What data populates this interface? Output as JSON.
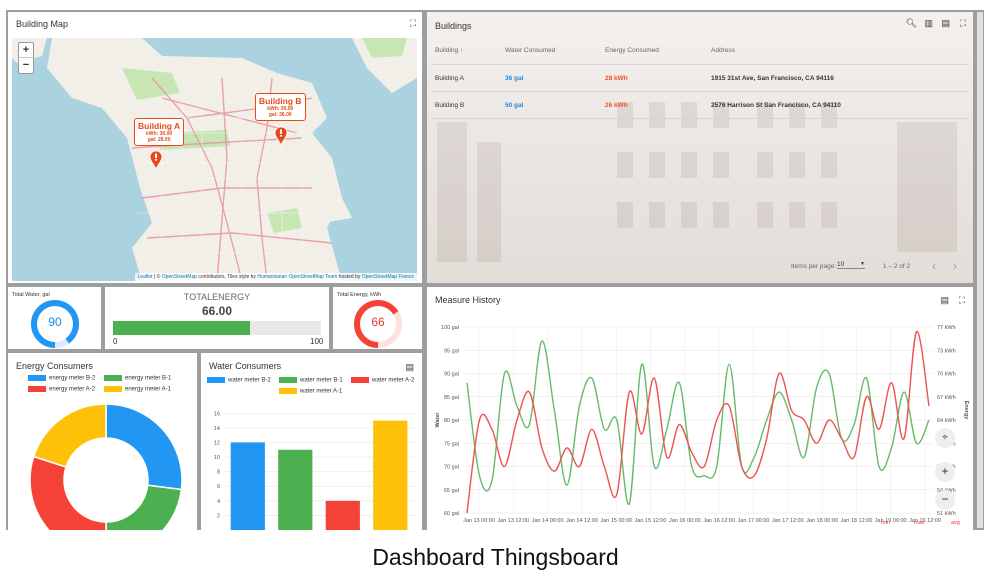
{
  "map": {
    "title": "Building Map",
    "zoom_in": "+",
    "zoom_out": "−",
    "popups": [
      {
        "name": "Building A",
        "kwh": "kWh: 36.00",
        "gal": "gal: 28.00"
      },
      {
        "name": "Building B",
        "kwh": "kWh: 36.00",
        "gal": "gal: 36.00"
      }
    ],
    "attribution": {
      "leaflet": "Leaflet",
      "sep1": " | © ",
      "osm": "OpenStreetMap",
      "mid": " contributors, Tiles style by ",
      "humanitarian": "Humanitarian OpenStreetMap Team",
      "hosted": " hosted by ",
      "france": "OpenStreetMap France"
    },
    "colors": {
      "water": "#aad3df",
      "land": "#f2efe9",
      "park": "#c8e6b4",
      "road": "#e892a2",
      "marker": "#e64a19"
    }
  },
  "buildings": {
    "title": "Buildings",
    "headers": {
      "building": "Building ↑",
      "water": "Water Consumed",
      "energy": "Energy Consumed",
      "address": "Address"
    },
    "rows": [
      {
        "building": "Building A",
        "water": "36 gal",
        "energy": "28 kWh",
        "address": "1915 31st Ave, San Francisco, CA 94116"
      },
      {
        "building": "Building B",
        "water": "50 gal",
        "energy": "26 kWh",
        "address": "2576 Harrison St San Francisco, CA 94110"
      }
    ],
    "items_per_page_label": "Items per page:",
    "items_per_page": "10",
    "range": "1 – 2 of 2",
    "prev": "‹",
    "next": "›"
  },
  "total_water": {
    "title": "Total Water, gal",
    "value": "90",
    "fraction": 0.9,
    "color": "#2196f3"
  },
  "total_energy": {
    "title": "TOTALENERGY",
    "value": "66.00",
    "fraction": 0.66,
    "min": "0",
    "max": "100",
    "color": "#4caf50"
  },
  "total_energy_kwh": {
    "title": "Total Energy, kWh",
    "value": "66",
    "fraction": 0.66,
    "color": "#f44336"
  },
  "energy_consumers": {
    "title": "Energy Consumers",
    "legend": [
      {
        "label": "energy meter B-2",
        "color": "#2196f3"
      },
      {
        "label": "energy meter B-1",
        "color": "#4caf50"
      },
      {
        "label": "energy meter A-2",
        "color": "#f44336"
      },
      {
        "label": "energy meter A-1",
        "color": "#ffc107"
      }
    ]
  },
  "water_consumers": {
    "title": "Water Consumers",
    "legend": [
      {
        "label": "water meter B-2",
        "color": "#2196f3"
      },
      {
        "label": "water meter B-1",
        "color": "#4caf50"
      },
      {
        "label": "water meter A-2",
        "color": "#f44336"
      },
      {
        "label": "water meter A-1",
        "color": "#ffc107"
      }
    ],
    "y_ticks": [
      "2",
      "4",
      "6",
      "8",
      "10",
      "12",
      "14",
      "16"
    ]
  },
  "measure_history": {
    "title": "Measure History",
    "left_axis_label": "Water",
    "right_axis_label": "Energy",
    "footer": {
      "min": "min",
      "max": "max",
      "avg": "avg"
    },
    "colors": {
      "water": "#66bb6a",
      "energy": "#ef5350"
    }
  },
  "chart_data": [
    {
      "type": "pie",
      "title": "Energy Consumers",
      "categories": [
        "energy meter B-2",
        "energy meter B-1",
        "energy meter A-2",
        "energy meter A-1"
      ],
      "values": [
        27,
        23,
        30,
        20
      ]
    },
    {
      "type": "bar",
      "title": "Water Consumers",
      "categories": [
        "water meter B-2",
        "water meter B-1",
        "water meter A-2",
        "water meter A-1"
      ],
      "values": [
        12,
        11,
        4,
        15
      ],
      "ylim": [
        0,
        17
      ]
    },
    {
      "type": "line",
      "title": "Measure History",
      "ylabel": "Water",
      "y2label": "Energy",
      "ylim": [
        60,
        100
      ],
      "y2lim": [
        51,
        77
      ],
      "y_ticks": [
        "100 gal",
        "95 gal",
        "90 gal",
        "85 gal",
        "80 gal",
        "75 gal",
        "70 gal",
        "65 gal",
        "60 gal"
      ],
      "y2_ticks": [
        "77 kWh",
        "73 kWh",
        "70 kWh",
        "67 kWh",
        "64 kWh",
        "61 kWh",
        "57 kWh",
        "54 kWh",
        "51 kWh"
      ],
      "x_ticks": [
        "Jan 13 00:00",
        "Jan 13 12:00",
        "Jan 14 00:00",
        "Jan 14 12:00",
        "Jan 15 00:00",
        "Jan 15 12:00",
        "Jan 16 00:00",
        "Jan 16 12:00",
        "Jan 17 00:00",
        "Jan 17 12:00",
        "Jan 18 00:00",
        "Jan 18 12:00",
        "Jan 19 00:00",
        "Jan 19 12:00"
      ],
      "series": [
        {
          "name": "Water",
          "values": [
            88,
            68,
            67,
            90,
            83,
            79,
            97,
            82,
            66,
            83,
            89,
            78,
            80,
            62,
            92,
            70,
            78,
            88,
            70,
            68,
            70,
            92,
            70,
            72,
            80,
            86,
            80,
            72,
            87,
            90,
            76,
            79,
            89,
            70,
            74,
            86,
            75,
            80
          ]
        },
        {
          "name": "Energy",
          "values": [
            60,
            80,
            78,
            70,
            80,
            86,
            74,
            69,
            74,
            70,
            78,
            70,
            64,
            86,
            77,
            89,
            72,
            79,
            73,
            70,
            80,
            83,
            70,
            68,
            76,
            90,
            82,
            80,
            75,
            80,
            76,
            72,
            85,
            78,
            88,
            76,
            99,
            83
          ]
        }
      ]
    }
  ],
  "caption": "Dashboard Thingsboard"
}
